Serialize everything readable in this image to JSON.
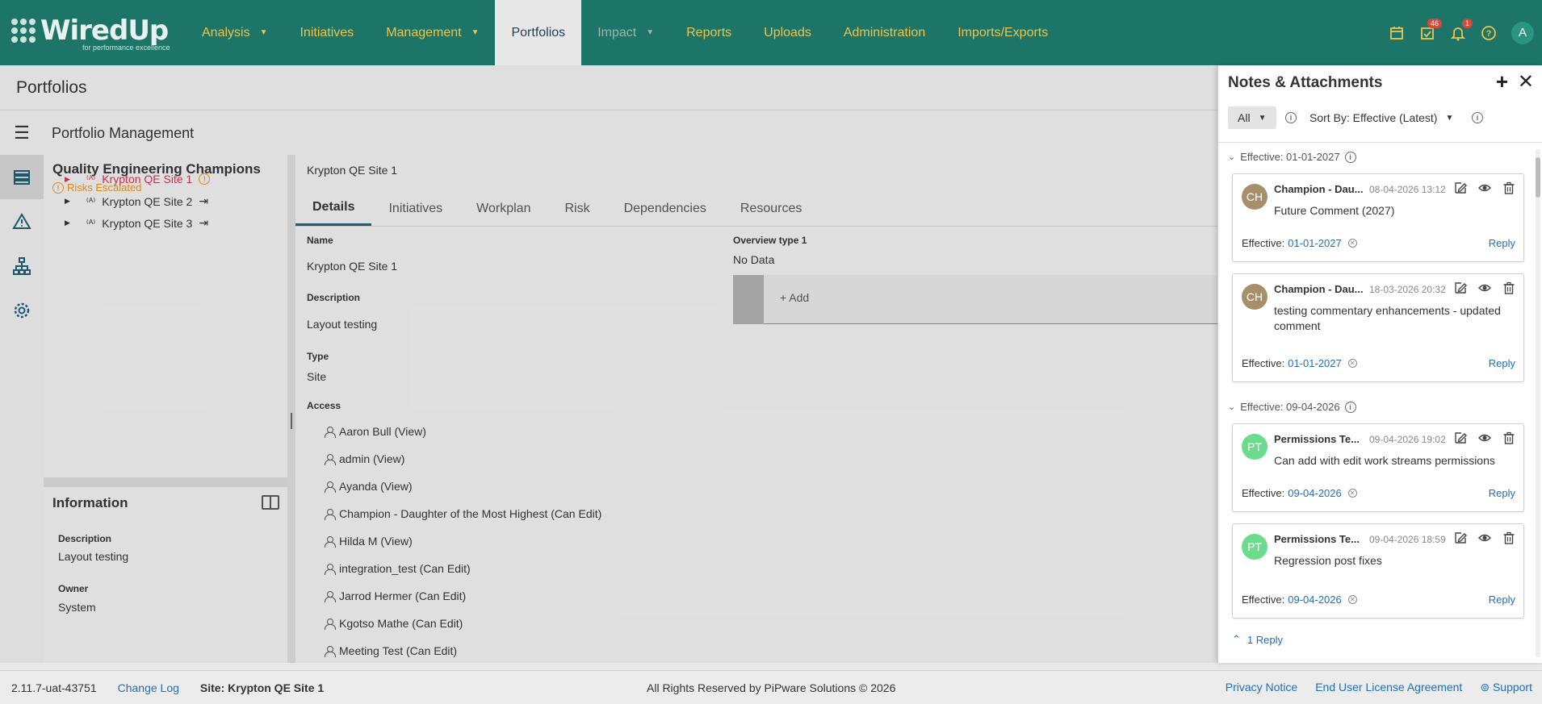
{
  "brand": {
    "name": "WiredUp",
    "tagline": "for performance excellence"
  },
  "nav": {
    "items": [
      {
        "label": "Analysis",
        "caret": true,
        "state": "normal"
      },
      {
        "label": "Initiatives",
        "caret": false,
        "state": "normal"
      },
      {
        "label": "Management",
        "caret": true,
        "state": "normal"
      },
      {
        "label": "Portfolios",
        "caret": false,
        "state": "active"
      },
      {
        "label": "Impact",
        "caret": true,
        "state": "dim"
      },
      {
        "label": "Reports",
        "caret": false,
        "state": "normal"
      },
      {
        "label": "Uploads",
        "caret": false,
        "state": "normal"
      },
      {
        "label": "Administration",
        "caret": false,
        "state": "normal"
      },
      {
        "label": "Imports/Exports",
        "caret": false,
        "state": "normal"
      }
    ],
    "tasks_badge": "46",
    "notifications_badge": "1",
    "user_initial": "A"
  },
  "page": {
    "title": "Portfolios",
    "subtitle": "Portfolio Management"
  },
  "tree": {
    "title": "Quality Engineering Champions",
    "status": "Risks Escalated",
    "items": [
      {
        "label": "Krypton QE Site 1"
      },
      {
        "label": "Krypton QE Site 2"
      },
      {
        "label": "Krypton QE Site 3"
      }
    ]
  },
  "info": {
    "title": "Information",
    "description_label": "Description",
    "description": "Layout testing",
    "owner_label": "Owner",
    "owner": "System"
  },
  "main": {
    "breadcrumb": "Krypton QE Site 1",
    "tabs": [
      "Details",
      "Initiatives",
      "Workplan",
      "Risk",
      "Dependencies",
      "Resources"
    ],
    "name_label": "Name",
    "name": "Krypton QE Site 1",
    "description_label": "Description",
    "description": "Layout testing",
    "type_label": "Type",
    "type": "Site",
    "access_label": "Access",
    "access": [
      "Aaron Bull (View)",
      "admin (View)",
      "Ayanda (View)",
      "Champion - Daughter of the Most Highest (Can Edit)",
      "Hilda M (View)",
      "integration_test (Can Edit)",
      "Jarrod Hermer (Can Edit)",
      "Kgotso Mathe (Can Edit)",
      "Meeting Test (Can Edit)"
    ],
    "overview_label": "Overview type 1",
    "overview_value": "No Data",
    "add_label": "+ Add"
  },
  "footer": {
    "version": "2.11.7-uat-43751",
    "changelog": "Change Log",
    "site": "Site: Krypton QE Site 1",
    "rights": "All Rights Reserved by PiPware Solutions © 2026",
    "privacy": "Privacy Notice",
    "eula": "End User License Agreement",
    "support": "Support"
  },
  "notes": {
    "title": "Notes & Attachments",
    "filter": "All",
    "sort": "Sort By: Effective (Latest)",
    "groups": [
      {
        "label": "Effective: 01-01-2027"
      },
      {
        "label": "Effective: 09-04-2026"
      }
    ],
    "effective_label": "Effective:",
    "reply_label": "Reply",
    "replies_label": "1 Reply",
    "cards": [
      {
        "initials": "CH",
        "author": "Champion - Dau...",
        "date": "08-04-2026 13:12",
        "text": "Future Comment (2027)",
        "effective": "01-01-2027",
        "avatar_color": "#a78f6c"
      },
      {
        "initials": "CH",
        "author": "Champion - Dau...",
        "date": "18-03-2026 20:32",
        "text": "testing commentary enhancements - updated comment",
        "effective": "01-01-2027",
        "avatar_color": "#a78f6c"
      },
      {
        "initials": "PT",
        "author": "Permissions Te...",
        "date": "09-04-2026 19:02",
        "text": "Can add with edit work streams permissions",
        "effective": "09-04-2026",
        "avatar_color": "#6bdb8c"
      },
      {
        "initials": "PT",
        "author": "Permissions Te...",
        "date": "09-04-2026 18:59",
        "text": "Regression post fixes",
        "effective": "09-04-2026",
        "avatar_color": "#6bdb8c"
      }
    ]
  }
}
